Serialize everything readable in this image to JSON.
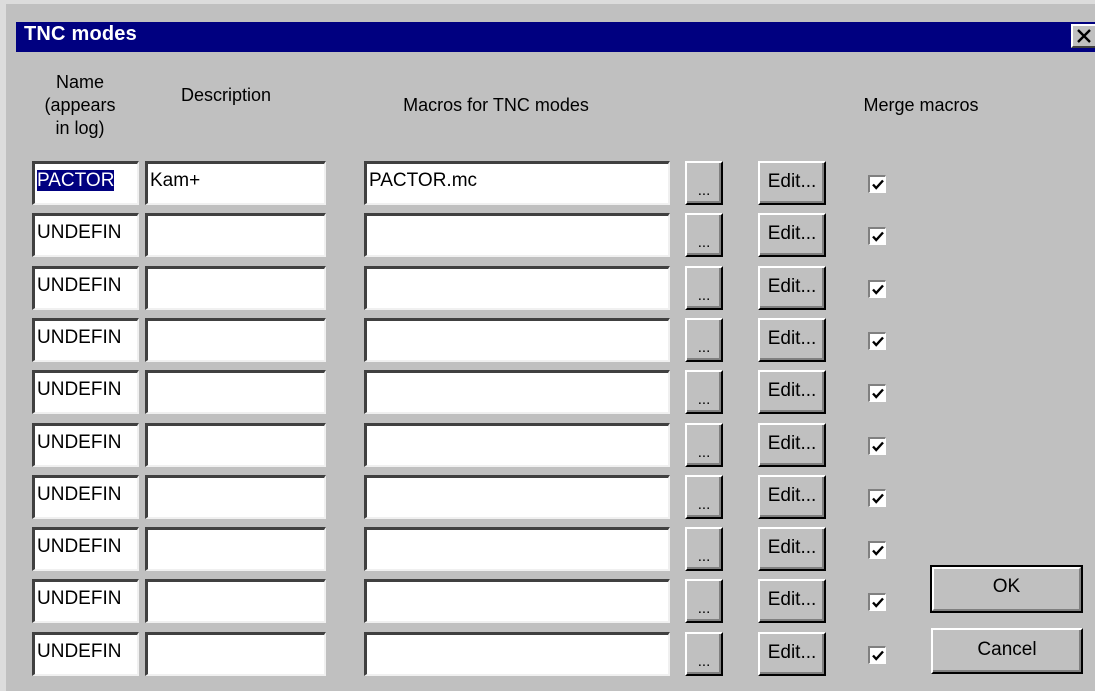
{
  "dialog": {
    "title": "TNC modes",
    "close_glyph": "✕"
  },
  "headers": {
    "name": "Name\n(appears\nin log)",
    "description": "Description",
    "macros": "Macros for TNC modes",
    "merge": "Merge macros"
  },
  "rows": [
    {
      "name": "PACTOR",
      "description": "Kam+",
      "macro": "PACTOR.mc",
      "browse": "...",
      "edit": "Edit...",
      "merge": true,
      "name_selected": true
    },
    {
      "name": "UNDEFIN",
      "description": "",
      "macro": "",
      "browse": "...",
      "edit": "Edit...",
      "merge": true
    },
    {
      "name": "UNDEFIN",
      "description": "",
      "macro": "",
      "browse": "...",
      "edit": "Edit...",
      "merge": true
    },
    {
      "name": "UNDEFIN",
      "description": "",
      "macro": "",
      "browse": "...",
      "edit": "Edit...",
      "merge": true
    },
    {
      "name": "UNDEFIN",
      "description": "",
      "macro": "",
      "browse": "...",
      "edit": "Edit...",
      "merge": true
    },
    {
      "name": "UNDEFIN",
      "description": "",
      "macro": "",
      "browse": "...",
      "edit": "Edit...",
      "merge": true
    },
    {
      "name": "UNDEFIN",
      "description": "",
      "macro": "",
      "browse": "...",
      "edit": "Edit...",
      "merge": true
    },
    {
      "name": "UNDEFIN",
      "description": "",
      "macro": "",
      "browse": "...",
      "edit": "Edit...",
      "merge": true
    },
    {
      "name": "UNDEFIN",
      "description": "",
      "macro": "",
      "browse": "...",
      "edit": "Edit...",
      "merge": true
    },
    {
      "name": "UNDEFIN",
      "description": "",
      "macro": "",
      "browse": "...",
      "edit": "Edit...",
      "merge": true
    }
  ],
  "buttons": {
    "ok": "OK",
    "cancel": "Cancel"
  },
  "colors": {
    "titlebar": "#000080",
    "face": "#c0c0c0",
    "selection": "#000080"
  }
}
